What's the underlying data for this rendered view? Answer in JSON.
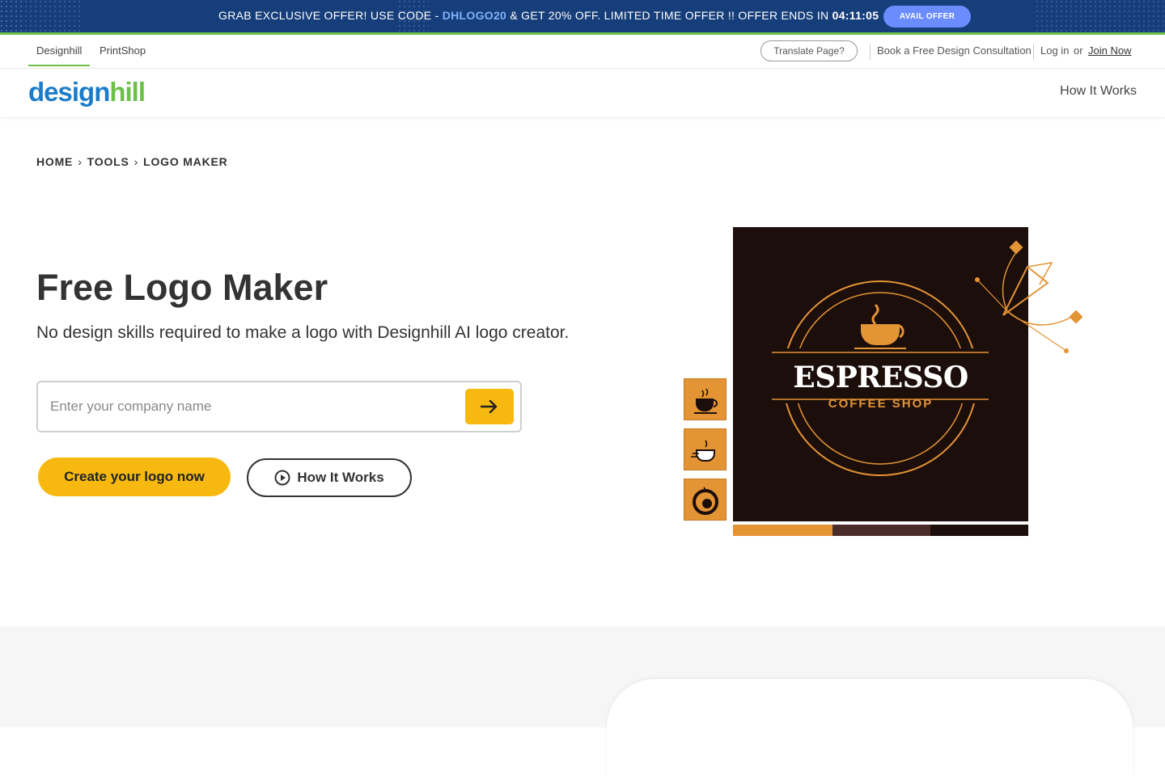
{
  "promo": {
    "text_before": "GRAB EXCLUSIVE OFFER! USE CODE - ",
    "code": "DHLOGO20",
    "text_after": " & GET 20% OFF. LIMITED TIME OFFER !! OFFER ENDS IN ",
    "timer": "04:11:05",
    "button": "AVAIL OFFER"
  },
  "utilnav": {
    "tabs": [
      "Designhill",
      "PrintShop"
    ],
    "translate": "Translate Page?",
    "consult": "Book a Free Design Consultation",
    "login": "Log in",
    "or": "or",
    "join": "Join Now"
  },
  "header": {
    "logo_part1": "design",
    "logo_part2": "hill",
    "how_it_works": "How It Works"
  },
  "breadcrumb": [
    "HOME",
    "TOOLS",
    "LOGO MAKER"
  ],
  "hero": {
    "title": "Free Logo Maker",
    "subtitle": "No design skills required to make a logo with Designhill AI logo creator.",
    "input_placeholder": "Enter your company name",
    "cta": "Create your logo now",
    "how_button": "How It Works"
  },
  "illustration": {
    "brand_name": "ESPRESSO",
    "brand_sub": "COFFEE SHOP",
    "swatches": [
      "#e39434",
      "#4a2c28",
      "#1c0e0b"
    ]
  },
  "colors": {
    "promo_bg": "#163e7a",
    "accent_green": "#6cc04a",
    "accent_yellow": "#f7b90f",
    "logo_blue": "#1c7cc9"
  }
}
